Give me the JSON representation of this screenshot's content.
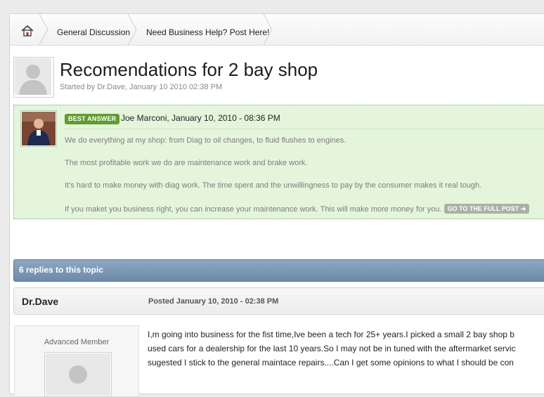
{
  "breadcrumb": {
    "home_icon": "home-icon",
    "items": [
      "General Discussion",
      "Need Business Help? Post Here!"
    ]
  },
  "topic": {
    "title": "Recomendations for 2 bay shop",
    "started_by": "Started by Dr.Dave, January 10 2010 02:38 PM"
  },
  "best_answer": {
    "badge": "BEST ANSWER",
    "author_line": "Joe Marconi, January 10, 2010 - 08:36 PM",
    "paragraphs": [
      "We do everything at my shop: from Diag to oil changes, to fluid flushes to engines.",
      "The most profitable work we do are maintenance work and brake work.",
      "It's hard to make money with diag work. The time spent and the unwillingness to pay by the consumer makes it real tough.",
      "If you maket you business right, you can increase your maintenance work. This will make more money for you."
    ],
    "go_button": "GO TO THE FULL POST ➜",
    "bg_color": "#e4f5dc",
    "badge_color": "#5f9d2e"
  },
  "replies_bar": {
    "label": "6 replies to this topic",
    "color": "#7993b0"
  },
  "post": {
    "author": "Dr.Dave",
    "posted": "Posted January 10, 2010 - 02:38 PM",
    "member_rank": "Advanced Member",
    "body_lines": [
      "I,m going into business for the fist time,Ive been a tech for 25+ years.I picked a small 2 bay shop b",
      "used cars for a dealership for the last 10 years.So I may not be in tuned with the aftermarket servic",
      "sugested I stick to the general maintace repairs....Can I get some opinions to what I should be con"
    ]
  }
}
